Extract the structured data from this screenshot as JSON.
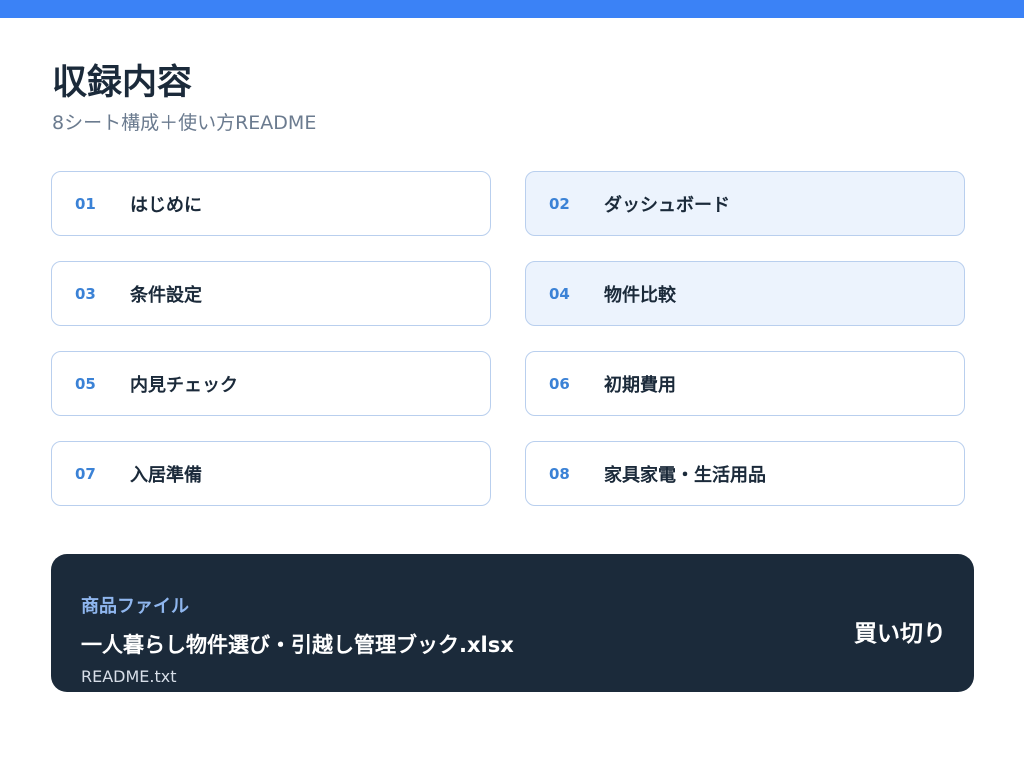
{
  "header": {
    "title": "収録内容",
    "subtitle": "8シート構成＋使い方README"
  },
  "sheets": [
    {
      "number": "01",
      "label": "はじめに"
    },
    {
      "number": "02",
      "label": "ダッシュボード"
    },
    {
      "number": "03",
      "label": "条件設定"
    },
    {
      "number": "04",
      "label": "物件比較"
    },
    {
      "number": "05",
      "label": "内見チェック"
    },
    {
      "number": "06",
      "label": "初期費用"
    },
    {
      "number": "07",
      "label": "入居準備"
    },
    {
      "number": "08",
      "label": "家具家電・生活用品"
    }
  ],
  "product": {
    "kicker": "商品ファイル",
    "filename": "一人暮らし物件選び・引越し管理ブック.xlsx",
    "readme": "README.txt",
    "price_label": "買い切り"
  },
  "colors": {
    "accent": "#3b82f6",
    "number": "#3b82d6",
    "card_border": "#b9cfee",
    "card_alt_bg": "#ecf3fd",
    "dark_panel": "#1b2a3a"
  }
}
